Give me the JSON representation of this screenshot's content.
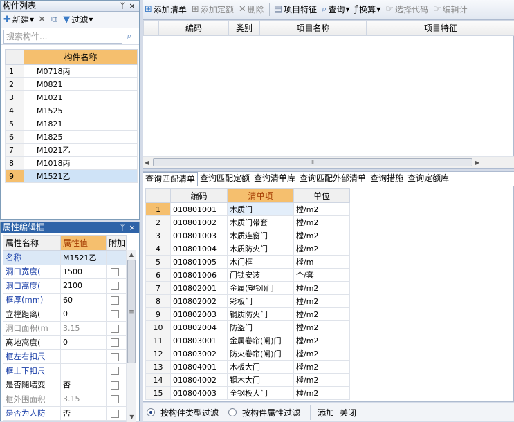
{
  "component_panel": {
    "title": "构件列表",
    "pin_icon": "ᛘ",
    "close_icon": "×",
    "toolbar": {
      "new_label": "新建",
      "filter_label": "过滤"
    },
    "search": {
      "placeholder": "搜索构件..."
    },
    "column_header": "构件名称",
    "rows": [
      {
        "num": "1",
        "name": "M0718丙"
      },
      {
        "num": "2",
        "name": "M0821"
      },
      {
        "num": "3",
        "name": "M1021"
      },
      {
        "num": "4",
        "name": "M1525"
      },
      {
        "num": "5",
        "name": "M1821"
      },
      {
        "num": "6",
        "name": "M1825"
      },
      {
        "num": "7",
        "name": "M1021乙"
      },
      {
        "num": "8",
        "name": "M1018丙"
      },
      {
        "num": "9",
        "name": "M1521乙"
      }
    ],
    "selected_row": "9"
  },
  "property_panel": {
    "title": "属性编辑框",
    "headers": {
      "name": "属性名称",
      "value": "属性值",
      "extra": "附加"
    },
    "rows": [
      {
        "name": "名称",
        "value": "M1521乙",
        "style": "blue"
      },
      {
        "name": "洞口宽度(",
        "value": "1500",
        "style": "blue"
      },
      {
        "name": "洞口高度(",
        "value": "2100",
        "style": "blue"
      },
      {
        "name": "框厚(mm)",
        "value": "60",
        "style": "blue"
      },
      {
        "name": "立樘距离(",
        "value": "0",
        "style": "black"
      },
      {
        "name": "洞口面积(m",
        "value": "3.15",
        "style": "gray"
      },
      {
        "name": "离地高度(",
        "value": "0",
        "style": "black"
      },
      {
        "name": "框左右扣尺",
        "value": "",
        "style": "blue"
      },
      {
        "name": "框上下扣尺",
        "value": "",
        "style": "blue"
      },
      {
        "name": "是否随墙变",
        "value": "否",
        "style": "black"
      },
      {
        "name": "框外围面积",
        "value": "3.15",
        "style": "gray"
      },
      {
        "name": "是否为人防",
        "value": "否",
        "style": "blue"
      }
    ]
  },
  "right_toolbar": {
    "add_list": "添加清单",
    "add_quota": "添加定额",
    "delete": "删除",
    "item_feature": "项目特征",
    "query": "查询",
    "convert": "换算",
    "select_code": "选择代码",
    "edit_calc": "编辑计"
  },
  "list_table": {
    "headers": [
      "编码",
      "类别",
      "项目名称",
      "项目特征"
    ]
  },
  "query_tabs": [
    "查询匹配清单",
    "查询匹配定额",
    "查询清单库",
    "查询匹配外部清单",
    "查询措施",
    "查询定额库"
  ],
  "active_query_tab": 0,
  "result_table": {
    "headers": {
      "code": "编码",
      "item": "清单项",
      "unit": "单位"
    },
    "rows": [
      {
        "num": "1",
        "code": "010801001",
        "name": "木质门",
        "unit": "樘/m2"
      },
      {
        "num": "2",
        "code": "010801002",
        "name": "木质门带套",
        "unit": "樘/m2"
      },
      {
        "num": "3",
        "code": "010801003",
        "name": "木质连窗门",
        "unit": "樘/m2"
      },
      {
        "num": "4",
        "code": "010801004",
        "name": "木质防火门",
        "unit": "樘/m2"
      },
      {
        "num": "5",
        "code": "010801005",
        "name": "木门框",
        "unit": "樘/m"
      },
      {
        "num": "6",
        "code": "010801006",
        "name": "门锁安装",
        "unit": "个/套"
      },
      {
        "num": "7",
        "code": "010802001",
        "name": "金属(塑钢)门",
        "unit": "樘/m2"
      },
      {
        "num": "8",
        "code": "010802002",
        "name": "彩板门",
        "unit": "樘/m2"
      },
      {
        "num": "9",
        "code": "010802003",
        "name": "钢质防火门",
        "unit": "樘/m2"
      },
      {
        "num": "10",
        "code": "010802004",
        "name": "防盗门",
        "unit": "樘/m2"
      },
      {
        "num": "11",
        "code": "010803001",
        "name": "金属卷帘(闸)门",
        "unit": "樘/m2"
      },
      {
        "num": "12",
        "code": "010803002",
        "name": "防火卷帘(闸)门",
        "unit": "樘/m2"
      },
      {
        "num": "13",
        "code": "010804001",
        "name": "木板大门",
        "unit": "樘/m2"
      },
      {
        "num": "14",
        "code": "010804002",
        "name": "钢木大门",
        "unit": "樘/m2"
      },
      {
        "num": "15",
        "code": "010804003",
        "name": "全钢板大门",
        "unit": "樘/m2"
      }
    ],
    "selected_row": "1"
  },
  "bottom_bar": {
    "filter_by_type": "按构件类型过滤",
    "filter_by_property": "按构件属性过滤",
    "add": "添加",
    "close": "关闭"
  }
}
